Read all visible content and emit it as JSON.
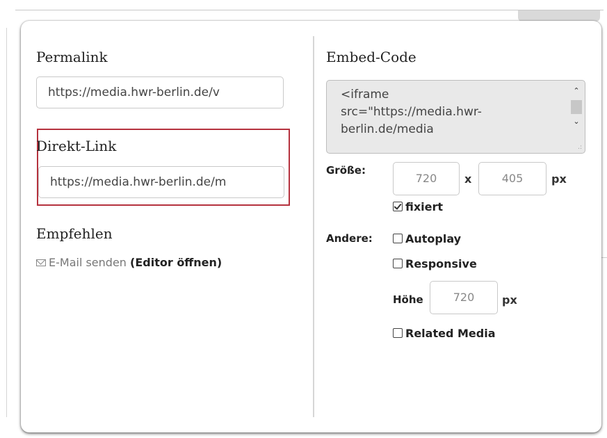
{
  "permalink": {
    "heading": "Permalink",
    "value": "https://media.hwr-berlin.de/v"
  },
  "direktlink": {
    "heading": "Direkt-Link",
    "value": "https://media.hwr-berlin.de/m"
  },
  "empfehlen": {
    "heading": "Empfehlen",
    "email_label": "E-Mail senden",
    "editor_label": "(Editor öffnen)"
  },
  "embed": {
    "heading": "Embed-Code",
    "code": "<iframe\nsrc=\"https://media.hwr-\nberlin.de/media"
  },
  "groesse": {
    "label": "Größe:",
    "width": "720",
    "x": "x",
    "height": "405",
    "unit": "px",
    "fixiert_label": "fixiert",
    "fixiert_checked": true
  },
  "andere": {
    "label": "Andere:",
    "autoplay_label": "Autoplay",
    "responsive_label": "Responsive",
    "hoehe_label": "Höhe",
    "hoehe_value": "720",
    "hoehe_unit": "px",
    "related_label": "Related Media"
  },
  "icons": {
    "email": "envelope-icon",
    "scroll_up": "chevron-up-icon",
    "scroll_down": "chevron-down-icon"
  }
}
